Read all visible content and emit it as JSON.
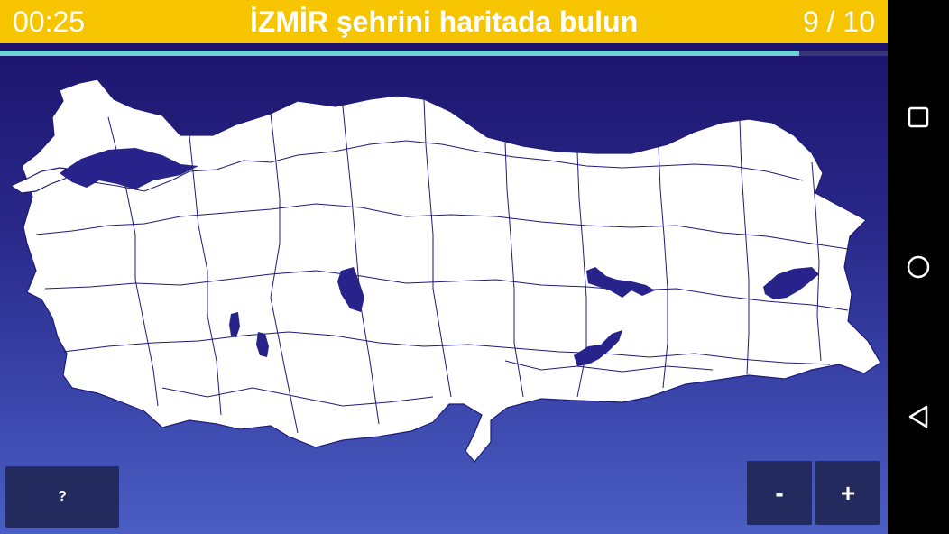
{
  "header": {
    "timer": "00:25",
    "question": "İZMİR şehrini haritada bulun",
    "counter": "9 / 10"
  },
  "progress": {
    "value": 0.9
  },
  "map": {
    "fill": "#ffffff",
    "border": "#1e1a78",
    "water": "#28238a"
  },
  "buttons": {
    "hint": "?",
    "zoom_out": "-",
    "zoom_in": "+"
  },
  "colors": {
    "topbar": "#f7c500",
    "button_bg": "#232a5e",
    "progress": "#6fd0d6"
  },
  "navbar": {
    "icons": [
      "recent-apps-icon",
      "home-icon",
      "back-icon"
    ]
  }
}
